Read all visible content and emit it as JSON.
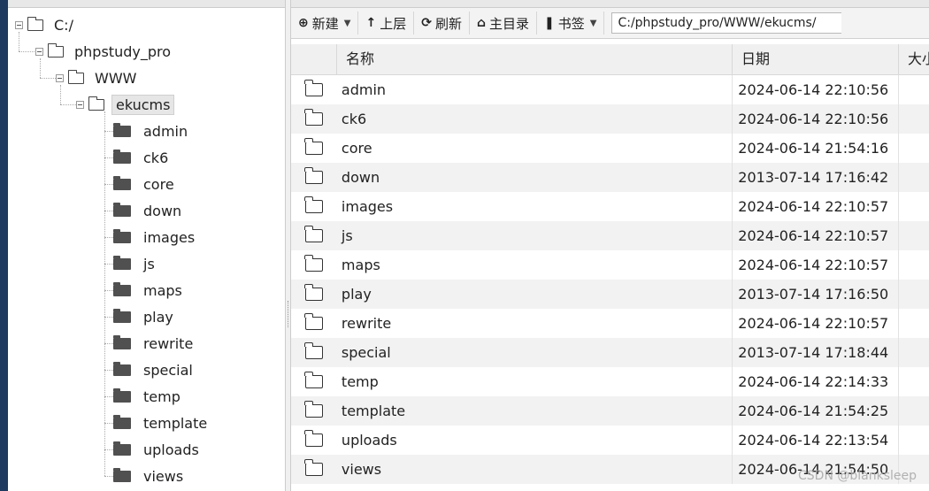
{
  "tree": {
    "root": {
      "label": "C:/"
    },
    "level1": {
      "label": "phpstudy_pro"
    },
    "level2": {
      "label": "WWW"
    },
    "level3": {
      "label": "ekucms"
    },
    "children": [
      "admin",
      "ck6",
      "core",
      "down",
      "images",
      "js",
      "maps",
      "play",
      "rewrite",
      "special",
      "temp",
      "template",
      "uploads",
      "views"
    ]
  },
  "toolbar": {
    "new_label": "新建",
    "up_label": "上层",
    "refresh_label": "刷新",
    "home_label": "主目录",
    "bookmark_label": "书签",
    "path_value": "C:/phpstudy_pro/WWW/ekucms/"
  },
  "table": {
    "columns": {
      "name": "名称",
      "date": "日期",
      "size": "大小"
    },
    "rows": [
      {
        "name": "admin",
        "date": "2024-06-14 22:10:56"
      },
      {
        "name": "ck6",
        "date": "2024-06-14 22:10:56"
      },
      {
        "name": "core",
        "date": "2024-06-14 21:54:16"
      },
      {
        "name": "down",
        "date": "2013-07-14 17:16:42"
      },
      {
        "name": "images",
        "date": "2024-06-14 22:10:57"
      },
      {
        "name": "js",
        "date": "2024-06-14 22:10:57"
      },
      {
        "name": "maps",
        "date": "2024-06-14 22:10:57"
      },
      {
        "name": "play",
        "date": "2013-07-14 17:16:50"
      },
      {
        "name": "rewrite",
        "date": "2024-06-14 22:10:57"
      },
      {
        "name": "special",
        "date": "2013-07-14 17:18:44"
      },
      {
        "name": "temp",
        "date": "2024-06-14 22:14:33"
      },
      {
        "name": "template",
        "date": "2024-06-14 21:54:25"
      },
      {
        "name": "uploads",
        "date": "2024-06-14 22:13:54"
      },
      {
        "name": "views",
        "date": "2024-06-14 21:54:50"
      }
    ]
  },
  "watermark": "CSDN @blanksleep",
  "colors": {
    "background": "#1e3a5f",
    "toolbar": "#f3f3f3",
    "stripe": "#f2f2f2"
  }
}
